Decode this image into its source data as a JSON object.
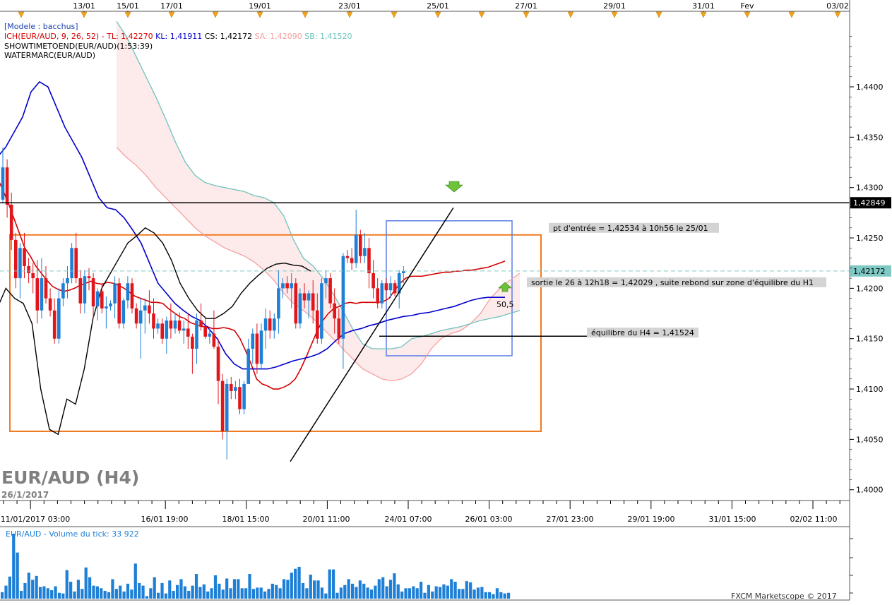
{
  "header": {
    "model": "[Modele : bacchus]",
    "ich": {
      "prefix": "ICH(EUR/AUD, 9, 26, 52) -",
      "tl": "TL: 1,42270",
      "kl": "KL: 1,41911",
      "cs": "CS: 1,42172",
      "sa": "SA: 1,42090",
      "sb": "SB: 1,41520"
    },
    "showtime": "SHOWTIMETOEND(EUR/AUD)(1:53:39)",
    "watermarc": "WATERMARC(EUR/AUD)"
  },
  "watermark": {
    "symbol": "EUR/AUD (H4)",
    "date": "26/1/2017"
  },
  "footer": {
    "credit": "FXCM Marketscope © 2017"
  },
  "colors": {
    "bull": "#1e7fd6",
    "bear": "#e0161b",
    "tenkan": "#d40000",
    "kijun": "#0000cc",
    "chikou": "#000000",
    "ssa": "#f5a0a0",
    "ssb": "#6fc3bd",
    "cloud": "#fdeaea",
    "box": "#f07a20",
    "zone": "#5b7ee6",
    "volume": "#1e7fd6",
    "volume_label": "#1a7fd6",
    "grid": "#c9c9c9"
  },
  "chart_data": [
    {
      "type": "candlestick",
      "title": "EUR/AUD (H4)",
      "ylim": [
        1.399,
        1.4475
      ],
      "y_ticks": [
        "1,4000",
        "1,4050",
        "1,4100",
        "1,4150",
        "1,4200",
        "1,4250",
        "1,4300",
        "1,4350",
        "1,4400"
      ],
      "top_date_labels": [
        "13/01",
        "15/01",
        "17/01",
        "19/01",
        "23/01",
        "25/01",
        "27/01",
        "29/01",
        "31/01",
        "Fev",
        "03/02"
      ],
      "bottom_time_labels": [
        "11/01/2017 03:00",
        "16/01 19:00",
        "18/01 15:00",
        "20/01 11:00",
        "24/01 07:00",
        "26/01 03:00",
        "27/01 23:00",
        "29/01 19:00",
        "31/01 15:00",
        "02/02 11:00"
      ],
      "candles": [
        [
          1.4288,
          1.434,
          1.4285,
          1.432
        ],
        [
          1.432,
          1.4328,
          1.427,
          1.4283
        ],
        [
          1.4283,
          1.4295,
          1.4238,
          1.4248
        ],
        [
          1.4248,
          1.4255,
          1.42,
          1.421
        ],
        [
          1.421,
          1.4245,
          1.419,
          1.424
        ],
        [
          1.424,
          1.4255,
          1.421,
          1.4222
        ],
        [
          1.4222,
          1.423,
          1.4205,
          1.4215
        ],
        [
          1.4215,
          1.4225,
          1.4195,
          1.421
        ],
        [
          1.421,
          1.4228,
          1.4165,
          1.4178
        ],
        [
          1.4178,
          1.423,
          1.417,
          1.421
        ],
        [
          1.421,
          1.4222,
          1.4185,
          1.419
        ],
        [
          1.419,
          1.42,
          1.4172,
          1.4178
        ],
        [
          1.4178,
          1.419,
          1.4145,
          1.415
        ],
        [
          1.415,
          1.42,
          1.4145,
          1.419
        ],
        [
          1.419,
          1.421,
          1.4182,
          1.4205
        ],
        [
          1.4205,
          1.4222,
          1.419,
          1.421
        ],
        [
          1.421,
          1.4245,
          1.4205,
          1.424
        ],
        [
          1.424,
          1.4255,
          1.4205,
          1.421
        ],
        [
          1.421,
          1.4218,
          1.4175,
          1.4185
        ],
        [
          1.4185,
          1.4218,
          1.4175,
          1.4212
        ],
        [
          1.4212,
          1.422,
          1.4198,
          1.421
        ],
        [
          1.421,
          1.4215,
          1.417,
          1.4182
        ],
        [
          1.4182,
          1.42,
          1.4168,
          1.4197
        ],
        [
          1.4197,
          1.4205,
          1.4175,
          1.418
        ],
        [
          1.418,
          1.4192,
          1.416,
          1.4182
        ],
        [
          1.4182,
          1.4188,
          1.4178,
          1.4185
        ],
        [
          1.4185,
          1.4212,
          1.417,
          1.4205
        ],
        [
          1.4205,
          1.421,
          1.416,
          1.4165
        ],
        [
          1.4165,
          1.419,
          1.416,
          1.4188
        ],
        [
          1.4188,
          1.4212,
          1.418,
          1.4205
        ],
        [
          1.4205,
          1.421,
          1.4175,
          1.418
        ],
        [
          1.418,
          1.4185,
          1.416,
          1.4165
        ],
        [
          1.4165,
          1.419,
          1.413,
          1.4178
        ],
        [
          1.4178,
          1.419,
          1.4155,
          1.4183
        ],
        [
          1.4183,
          1.4198,
          1.4165,
          1.4175
        ],
        [
          1.4175,
          1.419,
          1.415,
          1.416
        ],
        [
          1.416,
          1.417,
          1.4155,
          1.4165
        ],
        [
          1.4165,
          1.417,
          1.4145,
          1.415
        ],
        [
          1.415,
          1.4172,
          1.4135,
          1.4168
        ],
        [
          1.4168,
          1.4185,
          1.415,
          1.416
        ],
        [
          1.416,
          1.4175,
          1.4155,
          1.4168
        ],
        [
          1.4168,
          1.4176,
          1.4155,
          1.4158
        ],
        [
          1.4158,
          1.4168,
          1.4145,
          1.416
        ],
        [
          1.416,
          1.4175,
          1.414,
          1.4152
        ],
        [
          1.4152,
          1.4155,
          1.4115,
          1.414
        ],
        [
          1.414,
          1.4175,
          1.4125,
          1.4168
        ],
        [
          1.4168,
          1.4185,
          1.4158,
          1.4162
        ],
        [
          1.4162,
          1.4172,
          1.415,
          1.4152
        ],
        [
          1.4152,
          1.416,
          1.4145,
          1.4155
        ],
        [
          1.4155,
          1.4178,
          1.414,
          1.4142
        ],
        [
          1.4142,
          1.415,
          1.4085,
          1.4108
        ],
        [
          1.4108,
          1.4115,
          1.405,
          1.4058
        ],
        [
          1.4058,
          1.411,
          1.403,
          1.4105
        ],
        [
          1.4105,
          1.4112,
          1.409,
          1.4098
        ],
        [
          1.4098,
          1.4108,
          1.409,
          1.4102
        ],
        [
          1.4102,
          1.411,
          1.4075,
          1.408
        ],
        [
          1.408,
          1.4108,
          1.4075,
          1.4105
        ],
        [
          1.4105,
          1.415,
          1.411,
          1.414
        ],
        [
          1.414,
          1.416,
          1.4125,
          1.4155
        ],
        [
          1.4155,
          1.4165,
          1.4115,
          1.4125
        ],
        [
          1.4125,
          1.4165,
          1.412,
          1.4158
        ],
        [
          1.4158,
          1.418,
          1.414,
          1.417
        ],
        [
          1.417,
          1.4178,
          1.415,
          1.4158
        ],
        [
          1.4158,
          1.4175,
          1.415,
          1.417
        ],
        [
          1.417,
          1.4218,
          1.4155,
          1.42
        ],
        [
          1.42,
          1.421,
          1.419,
          1.4205
        ],
        [
          1.4205,
          1.4212,
          1.4195,
          1.42
        ],
        [
          1.42,
          1.4215,
          1.418,
          1.4205
        ],
        [
          1.4205,
          1.421,
          1.416,
          1.4165
        ],
        [
          1.4165,
          1.42,
          1.416,
          1.4195
        ],
        [
          1.4195,
          1.4205,
          1.418,
          1.4188
        ],
        [
          1.4188,
          1.4198,
          1.417,
          1.4195
        ],
        [
          1.4195,
          1.4208,
          1.4165,
          1.4178
        ],
        [
          1.4178,
          1.4195,
          1.4145,
          1.415
        ],
        [
          1.415,
          1.421,
          1.4145,
          1.4205
        ],
        [
          1.4205,
          1.4218,
          1.419,
          1.421
        ],
        [
          1.421,
          1.4215,
          1.418,
          1.4185
        ],
        [
          1.4185,
          1.42,
          1.4155,
          1.417
        ],
        [
          1.417,
          1.418,
          1.4145,
          1.415
        ],
        [
          1.415,
          1.4235,
          1.412,
          1.4232
        ],
        [
          1.4232,
          1.4238,
          1.4225,
          1.423
        ],
        [
          1.423,
          1.424,
          1.4218,
          1.4225
        ],
        [
          1.4225,
          1.4278,
          1.422,
          1.4253
        ],
        [
          1.4253,
          1.4258,
          1.4225,
          1.4232
        ],
        [
          1.4232,
          1.4255,
          1.4225,
          1.424
        ],
        [
          1.424,
          1.425,
          1.42,
          1.4215
        ],
        [
          1.4215,
          1.4228,
          1.419,
          1.42
        ],
        [
          1.42,
          1.421,
          1.418,
          1.4185
        ],
        [
          1.4185,
          1.4208,
          1.418,
          1.4205
        ],
        [
          1.4205,
          1.421,
          1.419,
          1.4198
        ],
        [
          1.4198,
          1.4212,
          1.419,
          1.4205
        ],
        [
          1.4205,
          1.4208,
          1.4192,
          1.4195
        ],
        [
          1.4195,
          1.4218,
          1.418,
          1.4215
        ],
        [
          1.4215,
          1.4222,
          1.4205,
          1.4217
        ]
      ],
      "tenkan": [
        1.431,
        1.4298,
        1.4285,
        1.427,
        1.4255,
        1.424,
        1.4232,
        1.4222,
        1.4215,
        1.4208,
        1.4202,
        1.4199,
        1.4197,
        1.4198,
        1.42,
        1.4203,
        1.4205,
        1.4207,
        1.4205,
        1.4204,
        1.4206,
        1.4205,
        1.4203,
        1.42,
        1.4196,
        1.4192,
        1.419,
        1.4188,
        1.4186,
        1.4186,
        1.4185,
        1.418,
        1.4176,
        1.4172,
        1.417,
        1.4166,
        1.4164,
        1.4162,
        1.4162,
        1.416,
        1.416,
        1.4161,
        1.416,
        1.4158,
        1.415,
        1.4138,
        1.4125,
        1.411,
        1.4105,
        1.4103,
        1.41,
        1.41,
        1.4102,
        1.4105,
        1.411,
        1.412,
        1.4132,
        1.4145,
        1.4158,
        1.4168,
        1.4175,
        1.418,
        1.4182,
        1.4185,
        1.4186,
        1.4185,
        1.4186,
        1.4186,
        1.4186,
        1.4186,
        1.4187,
        1.419,
        1.4198,
        1.4205,
        1.421,
        1.4212,
        1.4212,
        1.4212,
        1.4213,
        1.4214,
        1.4215,
        1.4216,
        1.4216,
        1.4217,
        1.4217,
        1.4218,
        1.4218,
        1.4219,
        1.422,
        1.4221,
        1.4223,
        1.4225,
        1.4227
      ],
      "kijun": [
        1.433,
        1.434,
        1.4355,
        1.437,
        1.4395,
        1.4405,
        1.44,
        1.438,
        1.436,
        1.4345,
        1.433,
        1.431,
        1.429,
        1.428,
        1.4278,
        1.427,
        1.4258,
        1.4245,
        1.4225,
        1.4205,
        1.4195,
        1.4185,
        1.4178,
        1.4172,
        1.4168,
        1.416,
        1.415,
        1.4135,
        1.4125,
        1.412,
        1.412,
        1.412,
        1.412,
        1.4122,
        1.4125,
        1.4128,
        1.413,
        1.4132,
        1.4135,
        1.414,
        1.4148,
        1.4155,
        1.4158,
        1.416,
        1.4163,
        1.4165,
        1.4168,
        1.417,
        1.4172,
        1.4173,
        1.4175,
        1.4176,
        1.4178,
        1.418,
        1.4182,
        1.4185,
        1.4188,
        1.419,
        1.4191,
        1.4191,
        1.4191
      ],
      "chikou": [
        1.418,
        1.42,
        1.419,
        1.4185,
        1.4165,
        1.41,
        1.406,
        1.4055,
        1.409,
        1.4085,
        1.412,
        1.417,
        1.42,
        1.4215,
        1.423,
        1.4245,
        1.4252,
        1.426,
        1.4255,
        1.4245,
        1.4228,
        1.4205,
        1.419,
        1.4178,
        1.417,
        1.417,
        1.4175,
        1.4182,
        1.4195,
        1.4205,
        1.4213,
        1.422,
        1.4224,
        1.4225,
        1.4223,
        1.4222,
        1.4217
      ],
      "ssa": [
        1.434,
        1.433,
        1.4322,
        1.4312,
        1.43,
        1.429,
        1.428,
        1.427,
        1.426,
        1.4252,
        1.4246,
        1.424,
        1.4236,
        1.4232,
        1.4226,
        1.4218,
        1.4208,
        1.4195,
        1.4185,
        1.4178,
        1.417,
        1.416,
        1.415,
        1.414,
        1.413,
        1.412,
        1.4115,
        1.411,
        1.4108,
        1.411,
        1.4115,
        1.4125,
        1.414,
        1.415,
        1.4155,
        1.4158,
        1.4165,
        1.4175,
        1.419,
        1.42,
        1.4208,
        1.4215
      ],
      "ssb": [
        1.4465,
        1.445,
        1.443,
        1.441,
        1.439,
        1.4368,
        1.4345,
        1.4325,
        1.4312,
        1.4305,
        1.4302,
        1.43,
        1.4298,
        1.4296,
        1.4292,
        1.429,
        1.4285,
        1.4272,
        1.4248,
        1.423,
        1.4222,
        1.421,
        1.4195,
        1.4178,
        1.416,
        1.4145,
        1.414,
        1.414,
        1.414,
        1.4142,
        1.415,
        1.4152,
        1.4155,
        1.4158,
        1.416,
        1.4162,
        1.4165,
        1.4168,
        1.417,
        1.4172,
        1.4175,
        1.4178
      ],
      "horizontal_lines": [
        {
          "label": "1,42849",
          "value": 1.42849,
          "style": "solid"
        },
        {
          "label": "1,42172",
          "value": 1.42172,
          "style": "dashed"
        }
      ],
      "annotations": [
        {
          "text": "pt d'entrée = 1,42534  à 10h56 le 25/01",
          "value": 1.426
        },
        {
          "text": "sortie le 26 à 12h18 = 1,42029 , suite rebond sur zone d'équilibre du H1",
          "value": 1.4206
        },
        {
          "text": "équilibre du H4 = 1,41524",
          "value": 1.4156
        },
        {
          "text": "50,5",
          "value": 1.418
        }
      ],
      "equilibrium_value": 1.41524,
      "range_box": {
        "top": 1.4253,
        "bottom": 1.4058
      },
      "zone_box": {
        "top": 1.4267,
        "bottom": 1.4133
      },
      "trendline": {
        "start": 1.4028,
        "end": 1.428
      }
    },
    {
      "type": "bar",
      "title": "EUR/AUD - Volume du tick: 33 922",
      "ylim": [
        0,
        100
      ],
      "values": [
        10,
        20,
        34,
        100,
        71,
        12,
        24,
        40,
        29,
        35,
        18,
        19,
        16,
        13,
        19,
        9,
        8,
        44,
        26,
        11,
        29,
        15,
        48,
        33,
        20,
        19,
        16,
        12,
        10,
        30,
        15,
        20,
        11,
        23,
        14,
        54,
        24,
        20,
        4,
        16,
        33,
        9,
        24,
        8,
        28,
        12,
        21,
        30,
        19,
        12,
        20,
        38,
        18,
        22,
        11,
        16,
        36,
        23,
        14,
        31,
        16,
        30,
        30,
        16,
        16,
        38,
        15,
        17,
        17,
        11,
        15,
        23,
        21,
        16,
        30,
        29,
        40,
        46,
        49,
        24,
        16,
        37,
        28,
        28,
        17,
        8,
        45,
        45,
        9,
        17,
        21,
        30,
        23,
        18,
        28,
        23,
        17,
        14,
        20,
        30,
        33,
        19,
        29,
        39,
        22,
        11,
        16,
        16,
        19,
        16,
        26,
        9,
        21,
        11,
        19,
        18,
        22,
        20,
        30,
        26,
        15,
        15,
        27,
        25,
        14,
        17,
        18,
        10,
        10,
        7,
        16,
        10,
        8,
        9
      ]
    }
  ]
}
